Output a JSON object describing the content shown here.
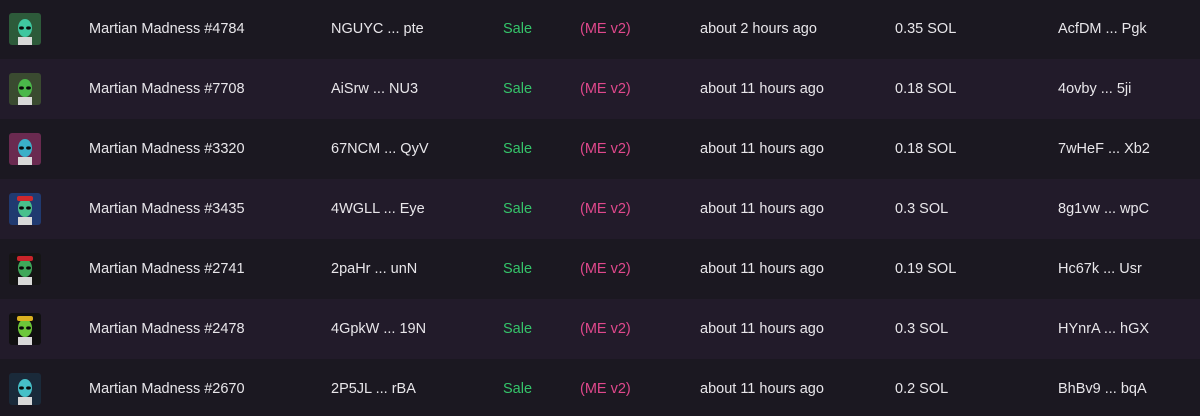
{
  "colors": {
    "sale": "#35c46a",
    "marketplace": "#e0488c",
    "text": "#e8e6ea"
  },
  "rows": [
    {
      "name": "Martian Madness #4784",
      "mint": "NGUYC ... pte",
      "type": "Sale",
      "marketplace": "(ME v2)",
      "time": "about 2 hours ago",
      "price": "0.35 SOL",
      "buyer": "AcfDM ... Pgk",
      "thumb": {
        "bg": "#2d5a3a",
        "alien": "#3fc7a0",
        "hat": ""
      }
    },
    {
      "name": "Martian Madness #7708",
      "mint": "AiSrw ... NU3",
      "type": "Sale",
      "marketplace": "(ME v2)",
      "time": "about 11 hours ago",
      "price": "0.18 SOL",
      "buyer": "4ovby ... 5ji",
      "thumb": {
        "bg": "#3a4a30",
        "alien": "#4ab84a",
        "hat": ""
      }
    },
    {
      "name": "Martian Madness #3320",
      "mint": "67NCM ... QyV",
      "type": "Sale",
      "marketplace": "(ME v2)",
      "time": "about 11 hours ago",
      "price": "0.18 SOL",
      "buyer": "7wHeF ... Xb2",
      "thumb": {
        "bg": "#6a2a50",
        "alien": "#3ab0c8",
        "hat": ""
      }
    },
    {
      "name": "Martian Madness #3435",
      "mint": "4WGLL ... Eye",
      "type": "Sale",
      "marketplace": "(ME v2)",
      "time": "about 11 hours ago",
      "price": "0.3 SOL",
      "buyer": "8g1vw ... wpC",
      "thumb": {
        "bg": "#203a70",
        "alien": "#49c08c",
        "hat": "#d0282c"
      }
    },
    {
      "name": "Martian Madness #2741",
      "mint": "2paHr ... unN",
      "type": "Sale",
      "marketplace": "(ME v2)",
      "time": "about 11 hours ago",
      "price": "0.19 SOL",
      "buyer": "Hc67k ... Usr",
      "thumb": {
        "bg": "#151515",
        "alien": "#3fa85a",
        "hat": "#c8242a"
      }
    },
    {
      "name": "Martian Madness #2478",
      "mint": "4GpkW ... 19N",
      "type": "Sale",
      "marketplace": "(ME v2)",
      "time": "about 11 hours ago",
      "price": "0.3 SOL",
      "buyer": "HYnrA ... hGX",
      "thumb": {
        "bg": "#101010",
        "alien": "#6cc83a",
        "hat": "#d9b020"
      }
    },
    {
      "name": "Martian Madness #2670",
      "mint": "2P5JL ... rBA",
      "type": "Sale",
      "marketplace": "(ME v2)",
      "time": "about 11 hours ago",
      "price": "0.2 SOL",
      "buyer": "BhBv9 ... bqA",
      "thumb": {
        "bg": "#1a2a3a",
        "alien": "#46c0c8",
        "hat": ""
      }
    }
  ]
}
